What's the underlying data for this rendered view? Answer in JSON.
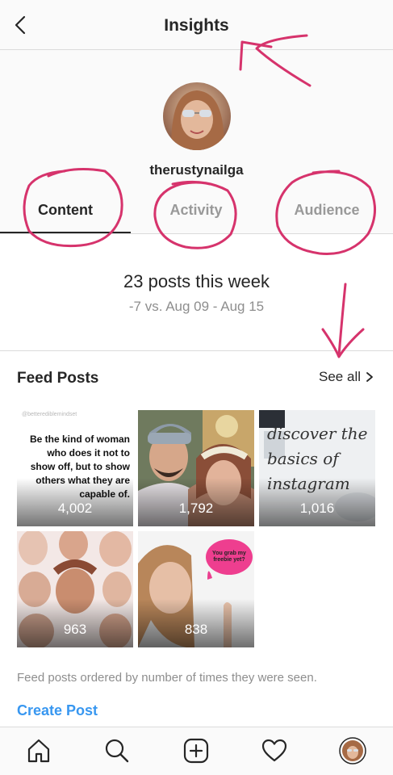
{
  "header": {
    "title": "Insights",
    "back_icon": "chevron-left-icon"
  },
  "profile": {
    "username": "therustynailga"
  },
  "tabs": [
    {
      "label": "Content",
      "active": true
    },
    {
      "label": "Activity",
      "active": false
    },
    {
      "label": "Audience",
      "active": false
    }
  ],
  "summary": {
    "main": "23 posts this week",
    "sub": "-7 vs. Aug 09 - Aug 15"
  },
  "feed": {
    "title": "Feed Posts",
    "see_all": "See all",
    "posts": [
      {
        "count": "4,002",
        "quote": "Be the kind of woman who does it not to show off, but to show others what they are capable of.",
        "watermark": "@betterediblemindset"
      },
      {
        "count": "1,792"
      },
      {
        "count": "1,016",
        "script_text": "discover the basics of instagram"
      },
      {
        "count": "963"
      },
      {
        "count": "838",
        "bubble_text": "You grab my freebie yet?"
      }
    ],
    "note": "Feed posts ordered by number of times they were seen.",
    "create_post": "Create Post"
  },
  "nav": {
    "items": [
      "home-icon",
      "search-icon",
      "new-post-icon",
      "activity-heart-icon",
      "profile-avatar"
    ]
  },
  "colors": {
    "link": "#3897f0",
    "annotation": "#d6336c",
    "divider": "#dbdbdb"
  }
}
